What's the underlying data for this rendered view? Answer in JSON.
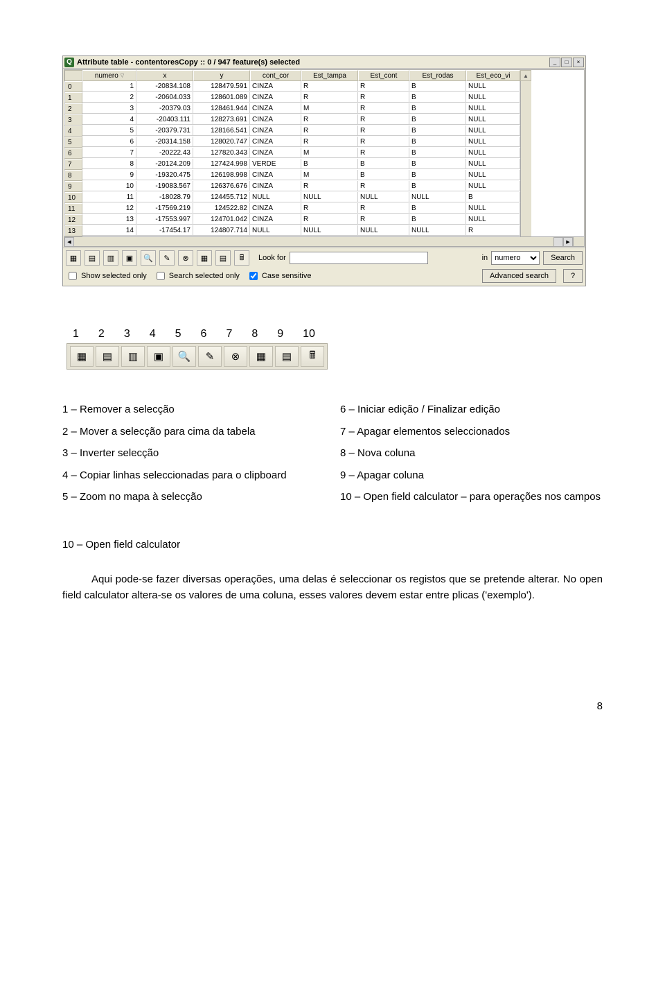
{
  "window": {
    "title": "Attribute table - contentoresCopy :: 0 / 947 feature(s) selected",
    "icon_letter": "Q"
  },
  "columns": [
    "numero",
    "x",
    "y",
    "cont_cor",
    "Est_tampa",
    "Est_cont",
    "Est_rodas",
    "Est_eco_vi"
  ],
  "rows": [
    {
      "i": "0",
      "numero": "1",
      "x": "-20834.108",
      "y": "128479.591",
      "cont_cor": "CINZA",
      "Est_tampa": "R",
      "Est_cont": "R",
      "Est_rodas": "B",
      "Est_eco_vi": "NULL"
    },
    {
      "i": "1",
      "numero": "2",
      "x": "-20604.033",
      "y": "128601.089",
      "cont_cor": "CINZA",
      "Est_tampa": "R",
      "Est_cont": "R",
      "Est_rodas": "B",
      "Est_eco_vi": "NULL"
    },
    {
      "i": "2",
      "numero": "3",
      "x": "-20379.03",
      "y": "128461.944",
      "cont_cor": "CINZA",
      "Est_tampa": "M",
      "Est_cont": "R",
      "Est_rodas": "B",
      "Est_eco_vi": "NULL"
    },
    {
      "i": "3",
      "numero": "4",
      "x": "-20403.111",
      "y": "128273.691",
      "cont_cor": "CINZA",
      "Est_tampa": "R",
      "Est_cont": "R",
      "Est_rodas": "B",
      "Est_eco_vi": "NULL"
    },
    {
      "i": "4",
      "numero": "5",
      "x": "-20379.731",
      "y": "128166.541",
      "cont_cor": "CINZA",
      "Est_tampa": "R",
      "Est_cont": "R",
      "Est_rodas": "B",
      "Est_eco_vi": "NULL"
    },
    {
      "i": "5",
      "numero": "6",
      "x": "-20314.158",
      "y": "128020.747",
      "cont_cor": "CINZA",
      "Est_tampa": "R",
      "Est_cont": "R",
      "Est_rodas": "B",
      "Est_eco_vi": "NULL"
    },
    {
      "i": "6",
      "numero": "7",
      "x": "-20222.43",
      "y": "127820.343",
      "cont_cor": "CINZA",
      "Est_tampa": "M",
      "Est_cont": "R",
      "Est_rodas": "B",
      "Est_eco_vi": "NULL"
    },
    {
      "i": "7",
      "numero": "8",
      "x": "-20124.209",
      "y": "127424.998",
      "cont_cor": "VERDE",
      "Est_tampa": "B",
      "Est_cont": "B",
      "Est_rodas": "B",
      "Est_eco_vi": "NULL"
    },
    {
      "i": "8",
      "numero": "9",
      "x": "-19320.475",
      "y": "126198.998",
      "cont_cor": "CINZA",
      "Est_tampa": "M",
      "Est_cont": "B",
      "Est_rodas": "B",
      "Est_eco_vi": "NULL"
    },
    {
      "i": "9",
      "numero": "10",
      "x": "-19083.567",
      "y": "126376.676",
      "cont_cor": "CINZA",
      "Est_tampa": "R",
      "Est_cont": "R",
      "Est_rodas": "B",
      "Est_eco_vi": "NULL"
    },
    {
      "i": "10",
      "numero": "11",
      "x": "-18028.79",
      "y": "124455.712",
      "cont_cor": "NULL",
      "Est_tampa": "NULL",
      "Est_cont": "NULL",
      "Est_rodas": "NULL",
      "Est_eco_vi": "B"
    },
    {
      "i": "11",
      "numero": "12",
      "x": "-17569.219",
      "y": "124522.82",
      "cont_cor": "CINZA",
      "Est_tampa": "R",
      "Est_cont": "R",
      "Est_rodas": "B",
      "Est_eco_vi": "NULL"
    },
    {
      "i": "12",
      "numero": "13",
      "x": "-17553.997",
      "y": "124701.042",
      "cont_cor": "CINZA",
      "Est_tampa": "R",
      "Est_cont": "R",
      "Est_rodas": "B",
      "Est_eco_vi": "NULL"
    },
    {
      "i": "13",
      "numero": "14",
      "x": "-17454.17",
      "y": "124807.714",
      "cont_cor": "NULL",
      "Est_tampa": "NULL",
      "Est_cont": "NULL",
      "Est_rodas": "NULL",
      "Est_eco_vi": "R"
    }
  ],
  "toolbar": {
    "lookfor_label": "Look for",
    "in_label": "in",
    "in_value": "numero",
    "search_label": "Search",
    "show_selected_label": "Show selected only",
    "search_selected_label": "Search selected only",
    "case_sensitive_label": "Case sensitive",
    "advanced_search_label": "Advanced search",
    "help_label": "?"
  },
  "numbers_row": [
    "1",
    "2",
    "3",
    "4",
    "5",
    "6",
    "7",
    "8",
    "9",
    "10"
  ],
  "bigbar_icons": [
    "▦",
    "▤",
    "▥",
    "▣",
    "🔍",
    "✎",
    "⊗",
    "▦",
    "▤",
    "🖩"
  ],
  "legend": {
    "l1": "1 – Remover a selecção",
    "r1": "6 – Iniciar edição / Finalizar edição",
    "l2": "2 – Mover a selecção para cima da tabela",
    "r2": "7 – Apagar elementos seleccionados",
    "l3": "3 – Inverter selecção",
    "r3": "8 – Nova coluna",
    "l4": "4 – Copiar linhas seleccionadas para o clipboard",
    "r4": "9 – Apagar coluna",
    "l5": "5 – Zoom no mapa à selecção",
    "r5": "10 – Open field calculator – para operações nos campos"
  },
  "section_heading": "10 – Open field calculator",
  "body_paragraph": "Aqui pode-se fazer diversas operações, uma delas é seleccionar os registos que se pretende alterar. No open field calculator altera-se os valores de uma coluna, esses valores devem estar entre plicas ('exemplo').",
  "page_number": "8"
}
